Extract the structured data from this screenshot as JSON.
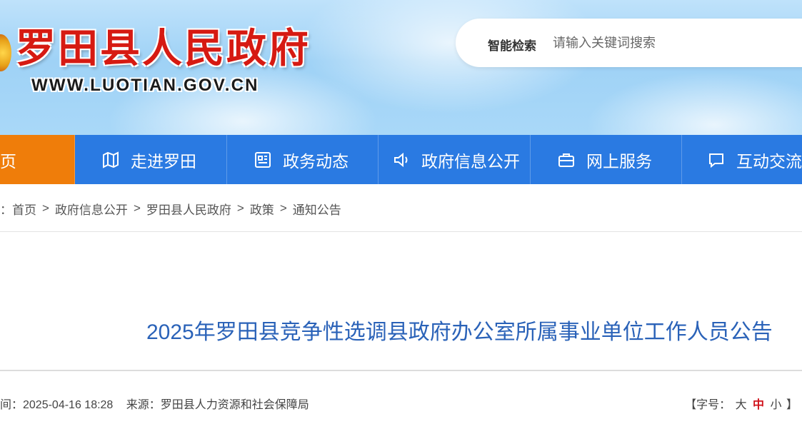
{
  "header": {
    "site_title": "罗田县人民政府",
    "site_url": "WWW.LUOTIAN.GOV.CN",
    "search_label": "智能检索",
    "search_placeholder": "请输入关键词搜索"
  },
  "nav": {
    "items": [
      {
        "label": "页",
        "icon": "home-icon"
      },
      {
        "label": "走进罗田",
        "icon": "map-icon"
      },
      {
        "label": "政务动态",
        "icon": "news-icon"
      },
      {
        "label": "政府信息公开",
        "icon": "speaker-icon"
      },
      {
        "label": "网上服务",
        "icon": "briefcase-icon"
      },
      {
        "label": "互动交流",
        "icon": "chat-icon"
      }
    ],
    "active_color": "#ef7d0a",
    "bg_color": "#2a7ae2"
  },
  "breadcrumb": {
    "prefix": "：",
    "items": [
      "首页",
      "政府信息公开",
      "罗田县人民政府",
      "政策",
      "通知公告"
    ],
    "separator": ">"
  },
  "article": {
    "title": "2025年罗田县竞争性选调县政府办公室所属事业单位工作人员公告",
    "time_label": "间：2025-04-16 18:28",
    "source_label": "来源：罗田县人力资源和社会保障局",
    "font_size_prefix": "【字号：",
    "font_large": "大",
    "font_medium": "中",
    "font_small": "小",
    "font_size_suffix": "】"
  }
}
